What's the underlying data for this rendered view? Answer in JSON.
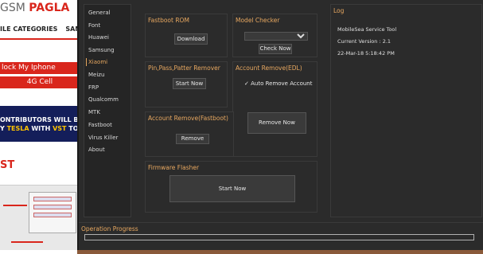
{
  "background_page": {
    "logo_left": "GSM ",
    "logo_right": "PAGLA",
    "nav_items": [
      "ILE CATEGORIES",
      "SAM"
    ],
    "red_bar_1": "lock My Iphone",
    "red_bar_2": "4G Cell",
    "banner_line1": "ONTRIBUTORS WILL BE ABL",
    "banner_line2_a": "Y ",
    "banner_line2_b": "TESLA",
    "banner_line2_c": " WITH ",
    "banner_line2_d": "VST",
    "banner_line2_e": " TOKENS!",
    "heading": "ST"
  },
  "sidebar": {
    "items": [
      {
        "label": "General"
      },
      {
        "label": "Font"
      },
      {
        "label": "Huawei"
      },
      {
        "label": "Samsung"
      },
      {
        "label": "Xiaomi"
      },
      {
        "label": "Meizu"
      },
      {
        "label": "FRP"
      },
      {
        "label": "Qualcomm"
      },
      {
        "label": "MTK"
      },
      {
        "label": "Fastboot"
      },
      {
        "label": "Virus Killer"
      },
      {
        "label": "About"
      }
    ],
    "active": "Xiaomi"
  },
  "panels": {
    "fastboot_rom": {
      "title": "Fastboot ROM",
      "button": "Download"
    },
    "model_checker": {
      "title": "Model Checker",
      "select_value": "",
      "button": "Check Now"
    },
    "pin_remover": {
      "title": "Pin,Pass,Patter Remover",
      "button": "Start Now"
    },
    "account_remove_edl": {
      "title": "Account Remove(EDL)",
      "checkbox_label": "Auto Remove Account",
      "checked": true,
      "button": "Remove Now"
    },
    "account_remove_fastboot": {
      "title": "Account Remove(Fastboot)",
      "button": "Remove"
    },
    "firmware_flasher": {
      "title": "Firmware Flasher",
      "button": "Start Now"
    }
  },
  "log": {
    "title": "Log",
    "lines": [
      "MobileSea Service Tool",
      "Current Version : 2.1",
      "22-Mar-18 5:18:42 PM"
    ]
  },
  "progress": {
    "title": "Operation Progress",
    "value": 0
  },
  "colors": {
    "accent": "#e8a860",
    "panel_bg": "#2b2b2b",
    "border": "#3a3a3a",
    "brand_red": "#d9261c"
  }
}
